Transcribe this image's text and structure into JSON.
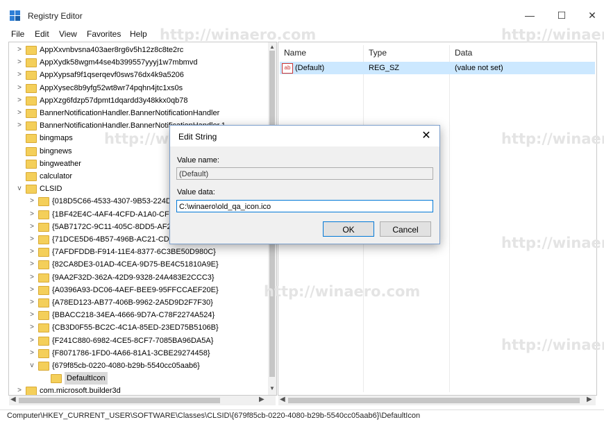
{
  "window": {
    "title": "Registry Editor",
    "minimize": "—",
    "maximize": "☐",
    "close": "✕"
  },
  "menu": [
    "File",
    "Edit",
    "View",
    "Favorites",
    "Help"
  ],
  "tree": {
    "items": [
      {
        "label": "AppXxvnbvsna403aer8rg6v5h12z8c8te2rc",
        "expander": ">"
      },
      {
        "label": "AppXydk58wgm44se4b399557yyyj1w7mbmvd",
        "expander": ">"
      },
      {
        "label": "AppXypsaf9f1qserqevf0sws76dx4k9a5206",
        "expander": ">"
      },
      {
        "label": "AppXysec8b9yfg52wt8wr74pqhn4jtc1xs0s",
        "expander": ">"
      },
      {
        "label": "AppXzg6fdzp57dpmt1dqardd3y48kkx0qb78",
        "expander": ">"
      },
      {
        "label": "BannerNotificationHandler.BannerNotificationHandler",
        "expander": ">"
      },
      {
        "label": "BannerNotificationHandler.BannerNotificationHandler.1",
        "expander": ">"
      },
      {
        "label": "bingmaps",
        "expander": ""
      },
      {
        "label": "bingnews",
        "expander": ""
      },
      {
        "label": "bingweather",
        "expander": ""
      },
      {
        "label": "calculator",
        "expander": ""
      },
      {
        "label": "CLSID",
        "expander": "v"
      },
      {
        "label": "{018D5C66-4533-4307-9B53-224DE2ED1FE6}",
        "expander": ">"
      },
      {
        "label": "{1BF42E4C-4AF4-4CFD-A1A0-CF2960B8F63E}",
        "expander": ">"
      },
      {
        "label": "{5AB7172C-9C11-405C-8DD5-AF20F3606282}",
        "expander": ">"
      },
      {
        "label": "{71DCE5D6-4B57-496B-AC21-CD5B54EB93FD}",
        "expander": ">"
      },
      {
        "label": "{7AFDFDDB-F914-11E4-8377-6C3BE50D980C}",
        "expander": ">"
      },
      {
        "label": "{82CA8DE3-01AD-4CEA-9D75-BE4C51810A9E}",
        "expander": ">"
      },
      {
        "label": "{9AA2F32D-362A-42D9-9328-24A483E2CCC3}",
        "expander": ">"
      },
      {
        "label": "{A0396A93-DC06-4AEF-BEE9-95FFCCAEF20E}",
        "expander": ">"
      },
      {
        "label": "{A78ED123-AB77-406B-9962-2A5D9D2F7F30}",
        "expander": ">"
      },
      {
        "label": "{BBACC218-34EA-4666-9D7A-C78F2274A524}",
        "expander": ">"
      },
      {
        "label": "{CB3D0F55-BC2C-4C1A-85ED-23ED75B5106B}",
        "expander": ">"
      },
      {
        "label": "{F241C880-6982-4CE5-8CF7-7085BA96DA5A}",
        "expander": ">"
      },
      {
        "label": "{F8071786-1FD0-4A66-81A1-3CBE29274458}",
        "expander": ">"
      },
      {
        "label": "{679f85cb-0220-4080-b29b-5540cc05aab6}",
        "expander": "v"
      },
      {
        "label": "DefaultIcon",
        "expander": ""
      },
      {
        "label": "com.microsoft.builder3d",
        "expander": ">"
      }
    ]
  },
  "list": {
    "columns": [
      "Name",
      "Type",
      "Data"
    ],
    "rows": [
      {
        "name": "(Default)",
        "type": "REG_SZ",
        "data": "(value not set)",
        "icon": "ab"
      }
    ]
  },
  "dialog": {
    "title": "Edit String",
    "value_name_label": "Value name:",
    "value_name": "(Default)",
    "value_data_label": "Value data:",
    "value_data": "C:\\winaero\\old_qa_icon.ico",
    "ok": "OK",
    "cancel": "Cancel",
    "close": "✕"
  },
  "status": "Computer\\HKEY_CURRENT_USER\\SOFTWARE\\Classes\\CLSID\\{679f85cb-0220-4080-b29b-5540cc05aab6}\\DefaultIcon",
  "watermark": "http://winaero.com"
}
